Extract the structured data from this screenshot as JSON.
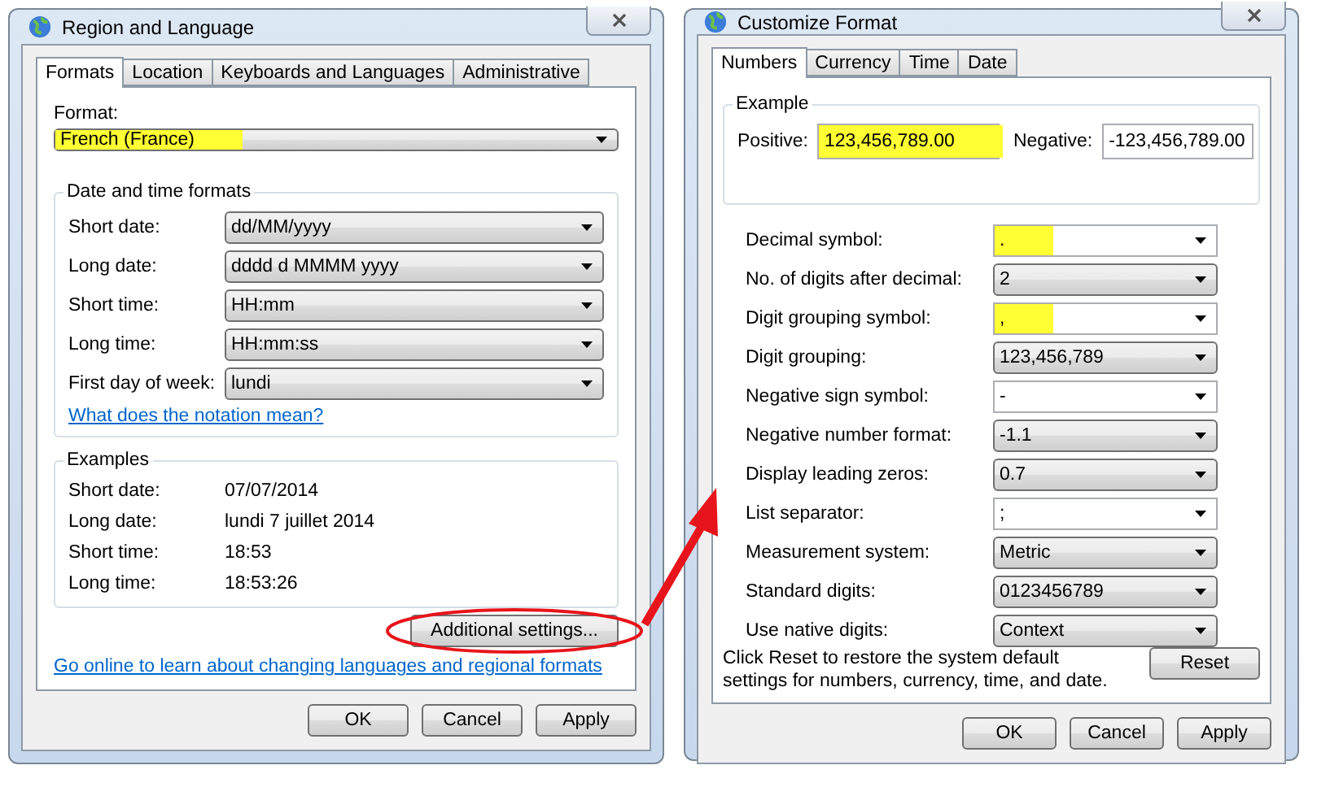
{
  "left_window": {
    "title": "Region and Language",
    "tabs": [
      {
        "label": "Formats",
        "selected": true
      },
      {
        "label": "Location",
        "selected": false
      },
      {
        "label": "Keyboards and Languages",
        "selected": false
      },
      {
        "label": "Administrative",
        "selected": false
      }
    ],
    "format": {
      "label": "Format:",
      "value": "French (France)",
      "highlighted": true
    },
    "date_time_group": {
      "title": "Date and time formats",
      "rows": [
        {
          "label": "Short date:",
          "value": "dd/MM/yyyy"
        },
        {
          "label": "Long date:",
          "value": "dddd d MMMM yyyy"
        },
        {
          "label": "Short time:",
          "value": "HH:mm"
        },
        {
          "label": "Long time:",
          "value": "HH:mm:ss"
        },
        {
          "label": "First day of week:",
          "value": "lundi"
        }
      ],
      "link": "What does the notation mean?"
    },
    "examples_group": {
      "title": "Examples",
      "rows": [
        {
          "label": "Short date:",
          "value": "07/07/2014"
        },
        {
          "label": "Long date:",
          "value": "lundi 7 juillet 2014"
        },
        {
          "label": "Short time:",
          "value": "18:53"
        },
        {
          "label": "Long time:",
          "value": "18:53:26"
        }
      ]
    },
    "additional_button": "Additional settings...",
    "online_link": "Go online to learn about changing languages and regional formats",
    "buttons": [
      "OK",
      "Cancel",
      "Apply"
    ]
  },
  "right_window": {
    "title": "Customize Format",
    "tabs": [
      {
        "label": "Numbers",
        "selected": true
      },
      {
        "label": "Currency",
        "selected": false
      },
      {
        "label": "Time",
        "selected": false
      },
      {
        "label": "Date",
        "selected": false
      }
    ],
    "example": {
      "title": "Example",
      "positive_label": "Positive:",
      "positive_value": "123,456,789.00",
      "positive_highlighted": true,
      "negative_label": "Negative:",
      "negative_value": "-123,456,789.00"
    },
    "settings": [
      {
        "label": "Decimal symbol:",
        "value": ".",
        "kind": "editable",
        "highlighted": true
      },
      {
        "label": "No. of digits after decimal:",
        "value": "2",
        "kind": "list",
        "highlighted": false
      },
      {
        "label": "Digit grouping symbol:",
        "value": ",",
        "kind": "editable",
        "highlighted": true
      },
      {
        "label": "Digit grouping:",
        "value": "123,456,789",
        "kind": "list",
        "highlighted": false
      },
      {
        "label": "Negative sign symbol:",
        "value": "-",
        "kind": "editable",
        "highlighted": false
      },
      {
        "label": "Negative number format:",
        "value": "-1.1",
        "kind": "list",
        "highlighted": false
      },
      {
        "label": "Display leading zeros:",
        "value": "0.7",
        "kind": "list",
        "highlighted": false
      },
      {
        "label": "List separator:",
        "value": ";",
        "kind": "editable",
        "highlighted": false
      },
      {
        "label": "Measurement system:",
        "value": "Metric",
        "kind": "list",
        "highlighted": false
      },
      {
        "label": "Standard digits:",
        "value": "0123456789",
        "kind": "list",
        "highlighted": false
      },
      {
        "label": "Use native digits:",
        "value": "Context",
        "kind": "list",
        "highlighted": false
      }
    ],
    "reset_note": "Click Reset to restore the system default settings for numbers, currency, time, and date.",
    "reset_button": "Reset",
    "buttons": [
      "OK",
      "Cancel",
      "Apply"
    ]
  }
}
